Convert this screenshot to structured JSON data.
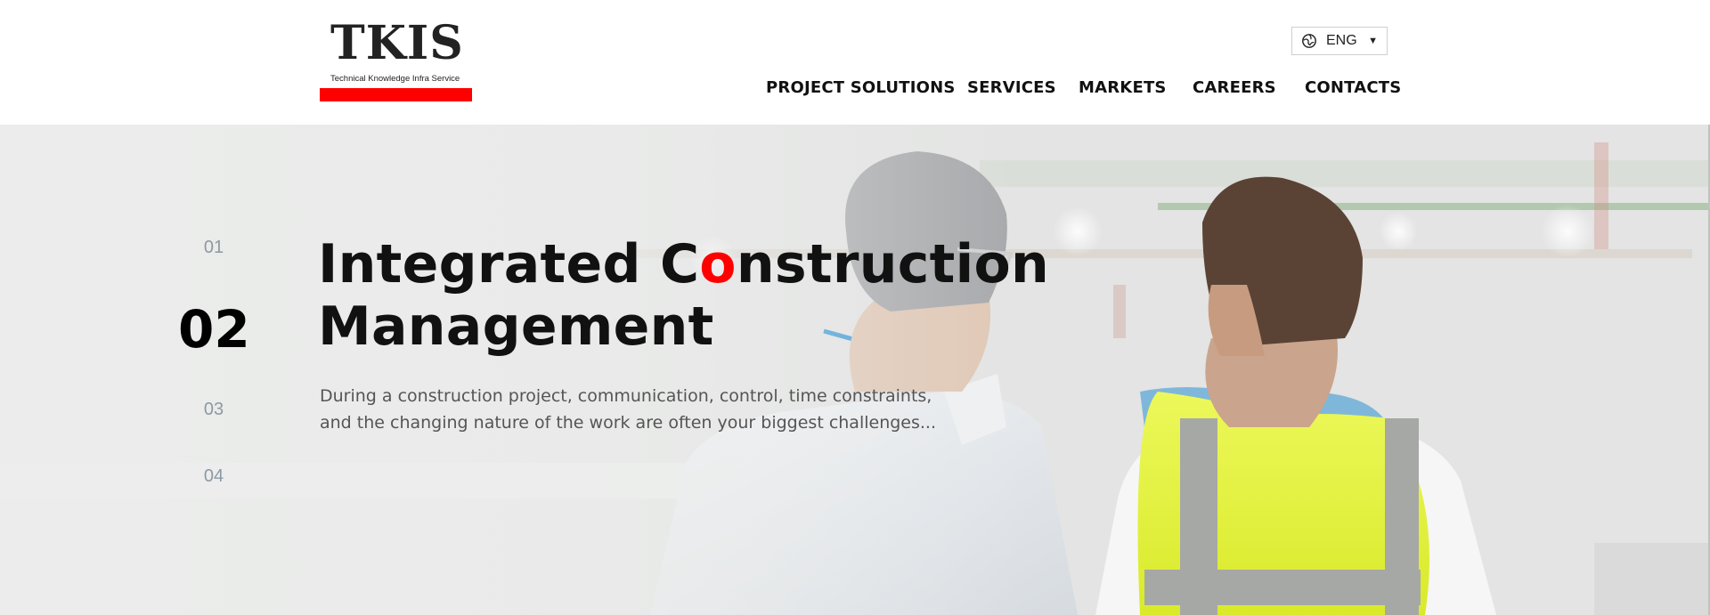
{
  "header": {
    "logo": {
      "text": "TKIS",
      "subtitle": "Technical Knowledge Infra Service",
      "accent_color": "#ff0000"
    },
    "language": {
      "icon": "globe-icon",
      "label": "ENG",
      "caret": "▼"
    },
    "nav": [
      {
        "label": "PROJECT SOLUTIONS"
      },
      {
        "label": "SERVICES"
      },
      {
        "label": "MARKETS"
      },
      {
        "label": "CAREERS"
      },
      {
        "label": "CONTACTS"
      }
    ]
  },
  "hero": {
    "slides": [
      "01",
      "02",
      "03",
      "04"
    ],
    "active_slide": "02",
    "title_line1_a": "Integrated C",
    "title_line1_highlight": "o",
    "title_line1_b": "nstruction",
    "title_line2": "Management",
    "description_line1": "During a construction project, communication, control, time constraints,",
    "description_line2": "and the changing nature of the work are often your biggest challenges...",
    "highlight_color": "#ff0000"
  }
}
